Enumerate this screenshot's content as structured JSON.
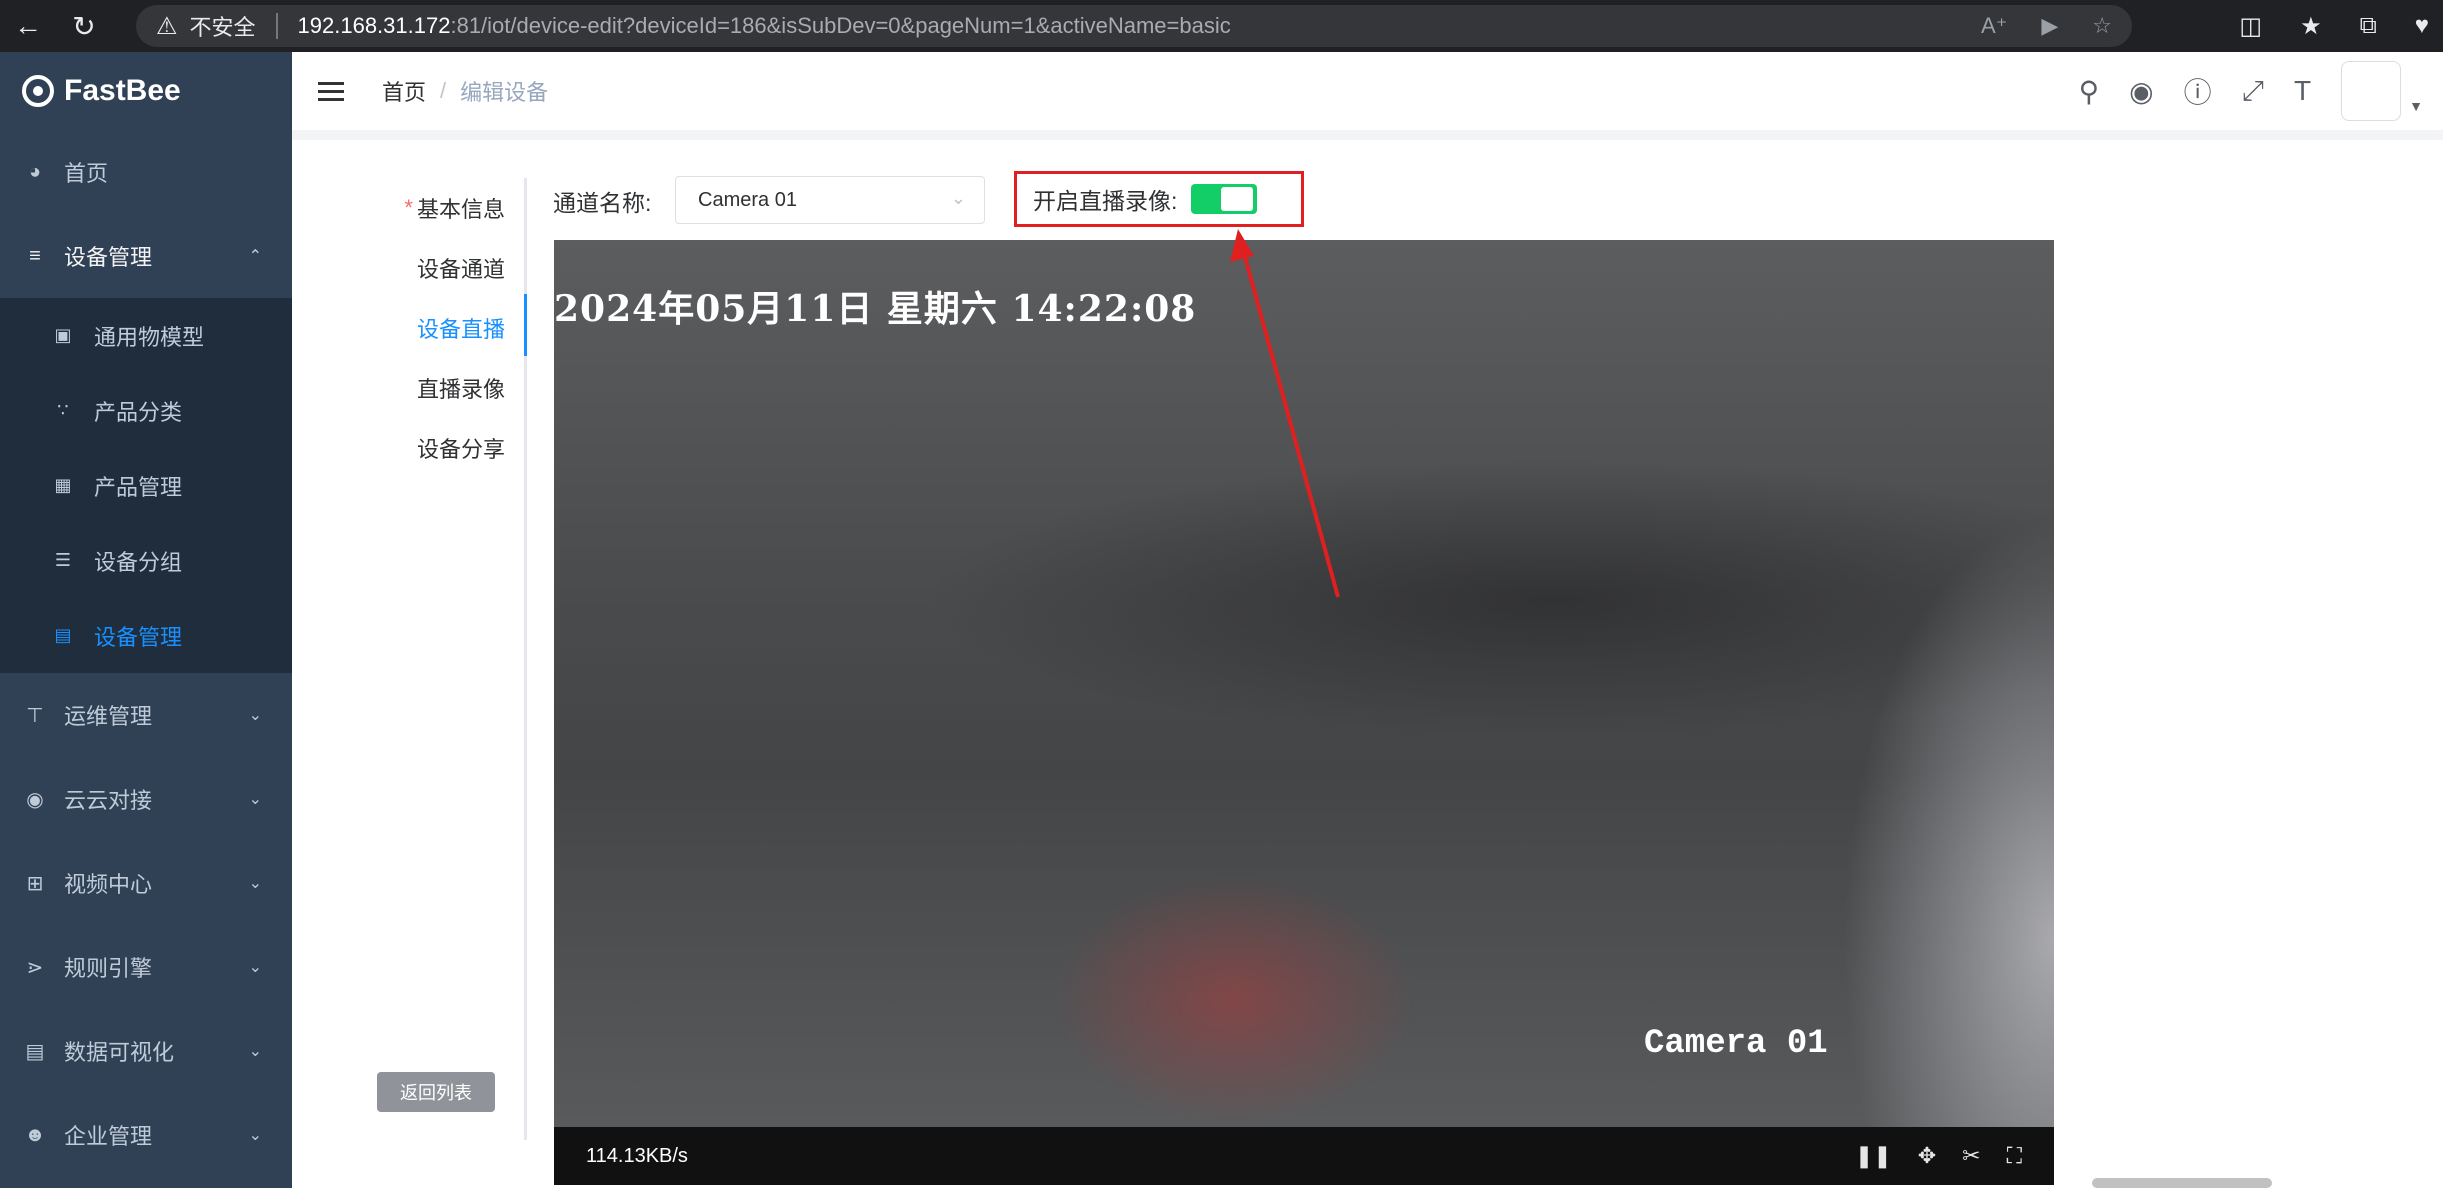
{
  "browser": {
    "insecure_label": "不安全",
    "url_host": "192.168.31.172",
    "url_path": ":81/iot/device-edit?deviceId=186&isSubDev=0&pageNum=1&activeName=basic"
  },
  "app": {
    "logo": "FastBee"
  },
  "sidebar": {
    "items": [
      {
        "label": "首页",
        "icon": "dashboard-icon"
      },
      {
        "label": "设备管理",
        "icon": "layers-icon",
        "open": true,
        "children": [
          {
            "label": "通用物模型",
            "icon": "cube-icon"
          },
          {
            "label": "产品分类",
            "icon": "tree-icon"
          },
          {
            "label": "产品管理",
            "icon": "grid-icon"
          },
          {
            "label": "设备分组",
            "icon": "list-icon"
          },
          {
            "label": "设备管理",
            "icon": "server-icon",
            "active": true
          }
        ]
      },
      {
        "label": "运维管理",
        "icon": "org-chart-icon"
      },
      {
        "label": "云云对接",
        "icon": "eye-icon"
      },
      {
        "label": "视频中心",
        "icon": "table-icon"
      },
      {
        "label": "规则引擎",
        "icon": "share-icon"
      },
      {
        "label": "数据可视化",
        "icon": "monitor-icon"
      },
      {
        "label": "企业管理",
        "icon": "user-group-icon"
      }
    ]
  },
  "breadcrumb": {
    "home": "首页",
    "current": "编辑设备"
  },
  "tabs": [
    {
      "label": "基本信息",
      "required": "*"
    },
    {
      "label": "设备通道"
    },
    {
      "label": "设备直播",
      "active": true
    },
    {
      "label": "直播录像"
    },
    {
      "label": "设备分享"
    }
  ],
  "back_button": "返回列表",
  "form": {
    "channel_label": "通道名称:",
    "channel_value": "Camera 01",
    "record_label": "开启直播录像:",
    "record_enabled": true
  },
  "video": {
    "osd_datetime": "2024年05月11日 星期六 14:22:08",
    "osd_camera": "Camera 01",
    "speed": "114.13KB/s"
  },
  "colors": {
    "sidebar": "#304156",
    "accent": "#1890ff",
    "switch_on": "#13ce66",
    "highlight": "#e02020"
  }
}
